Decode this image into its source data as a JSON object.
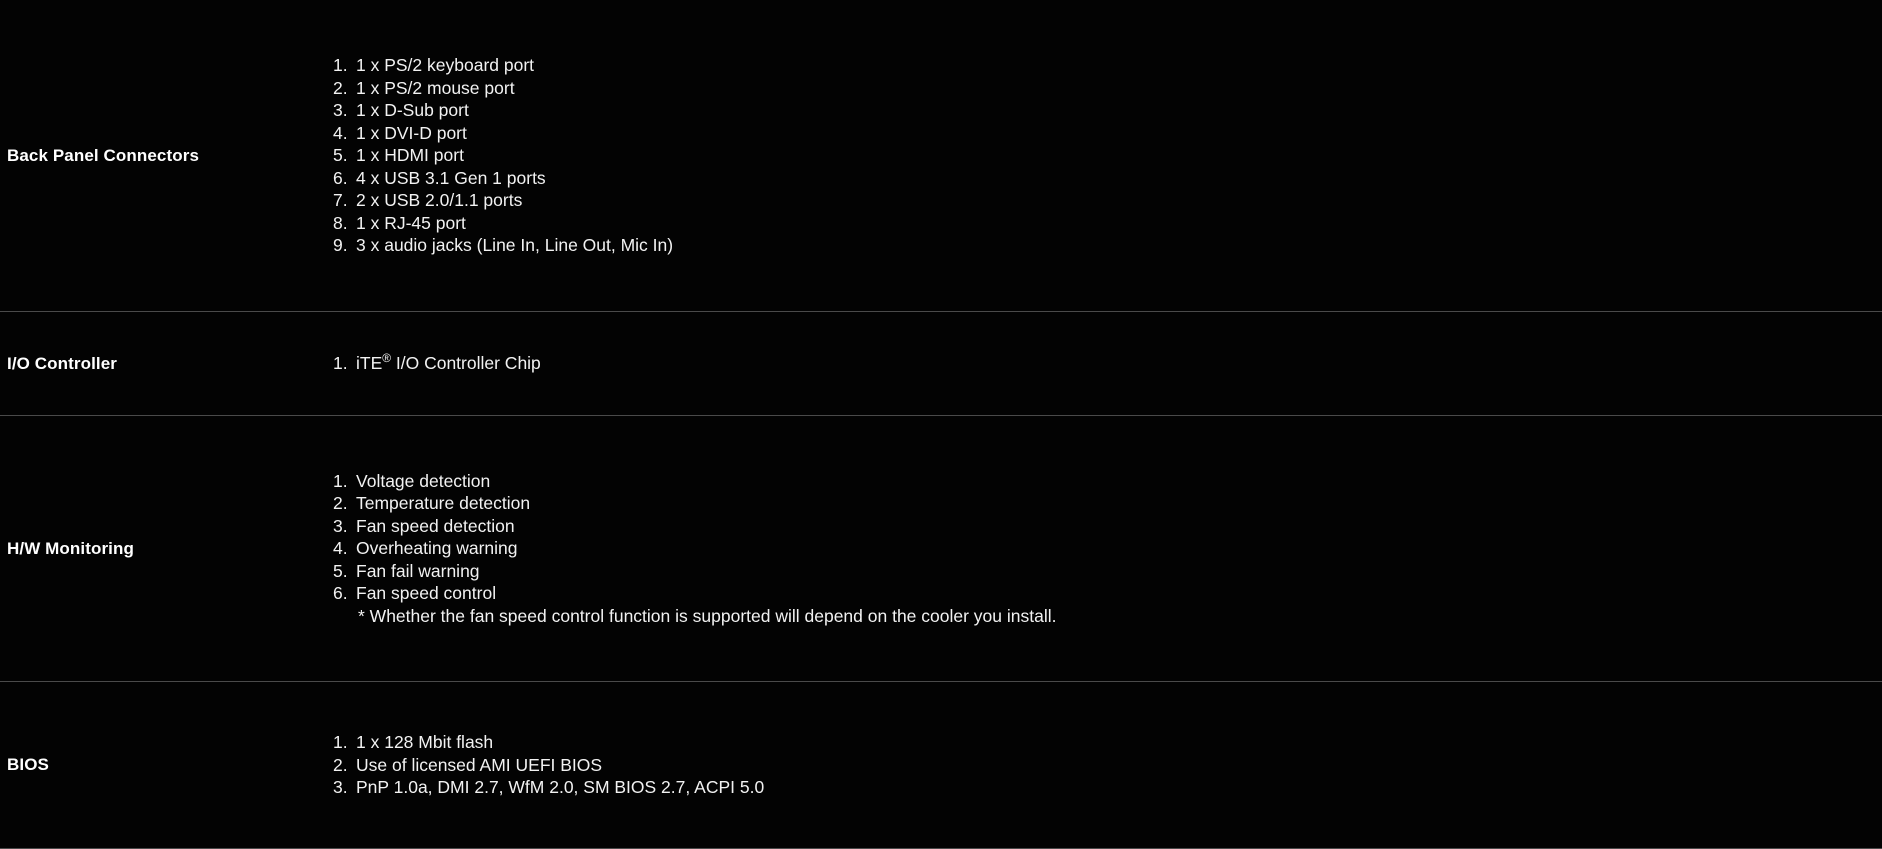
{
  "table": {
    "rows": [
      {
        "label": "Back Panel Connectors",
        "items": [
          {
            "num": "1.",
            "text": "1 x PS/2 keyboard port"
          },
          {
            "num": "2.",
            "text": "1 x PS/2 mouse port"
          },
          {
            "num": "3.",
            "text": "1 x D-Sub port"
          },
          {
            "num": "4.",
            "text": "1 x DVI-D port"
          },
          {
            "num": "5.",
            "text": "1 x HDMI port"
          },
          {
            "num": "6.",
            "text": "4 x USB 3.1 Gen 1 ports"
          },
          {
            "num": "7.",
            "text": "2 x USB 2.0/1.1 ports"
          },
          {
            "num": "8.",
            "text": "1 x RJ-45 port"
          },
          {
            "num": "9.",
            "text": "3 x audio jacks (Line In, Line Out, Mic In)"
          }
        ],
        "note": ""
      },
      {
        "label": "I/O Controller",
        "items": [
          {
            "num": "1.",
            "text_before_sup": "iTE",
            "sup": "®",
            "text_after_sup": " I/O Controller Chip"
          }
        ],
        "note": ""
      },
      {
        "label": "H/W Monitoring",
        "items": [
          {
            "num": "1.",
            "text": "Voltage detection"
          },
          {
            "num": "2.",
            "text": "Temperature detection"
          },
          {
            "num": "3.",
            "text": "Fan speed detection"
          },
          {
            "num": "4.",
            "text": "Overheating warning"
          },
          {
            "num": "5.",
            "text": "Fan fail warning"
          },
          {
            "num": "6.",
            "text": "Fan speed control"
          }
        ],
        "note": "* Whether the fan speed control function is supported will depend on the cooler you install."
      },
      {
        "label": "BIOS",
        "items": [
          {
            "num": "1.",
            "text": "1 x 128 Mbit flash"
          },
          {
            "num": "2.",
            "text": "Use of licensed AMI UEFI BIOS"
          },
          {
            "num": "3.",
            "text": "PnP 1.0a, DMI 2.7, WfM 2.0, SM BIOS 2.7, ACPI 5.0"
          }
        ],
        "note": ""
      }
    ]
  },
  "colors": {
    "background": "#000000",
    "text": "#f2f2f2",
    "label": "#ffffff",
    "divider": "#4a4a4a"
  }
}
